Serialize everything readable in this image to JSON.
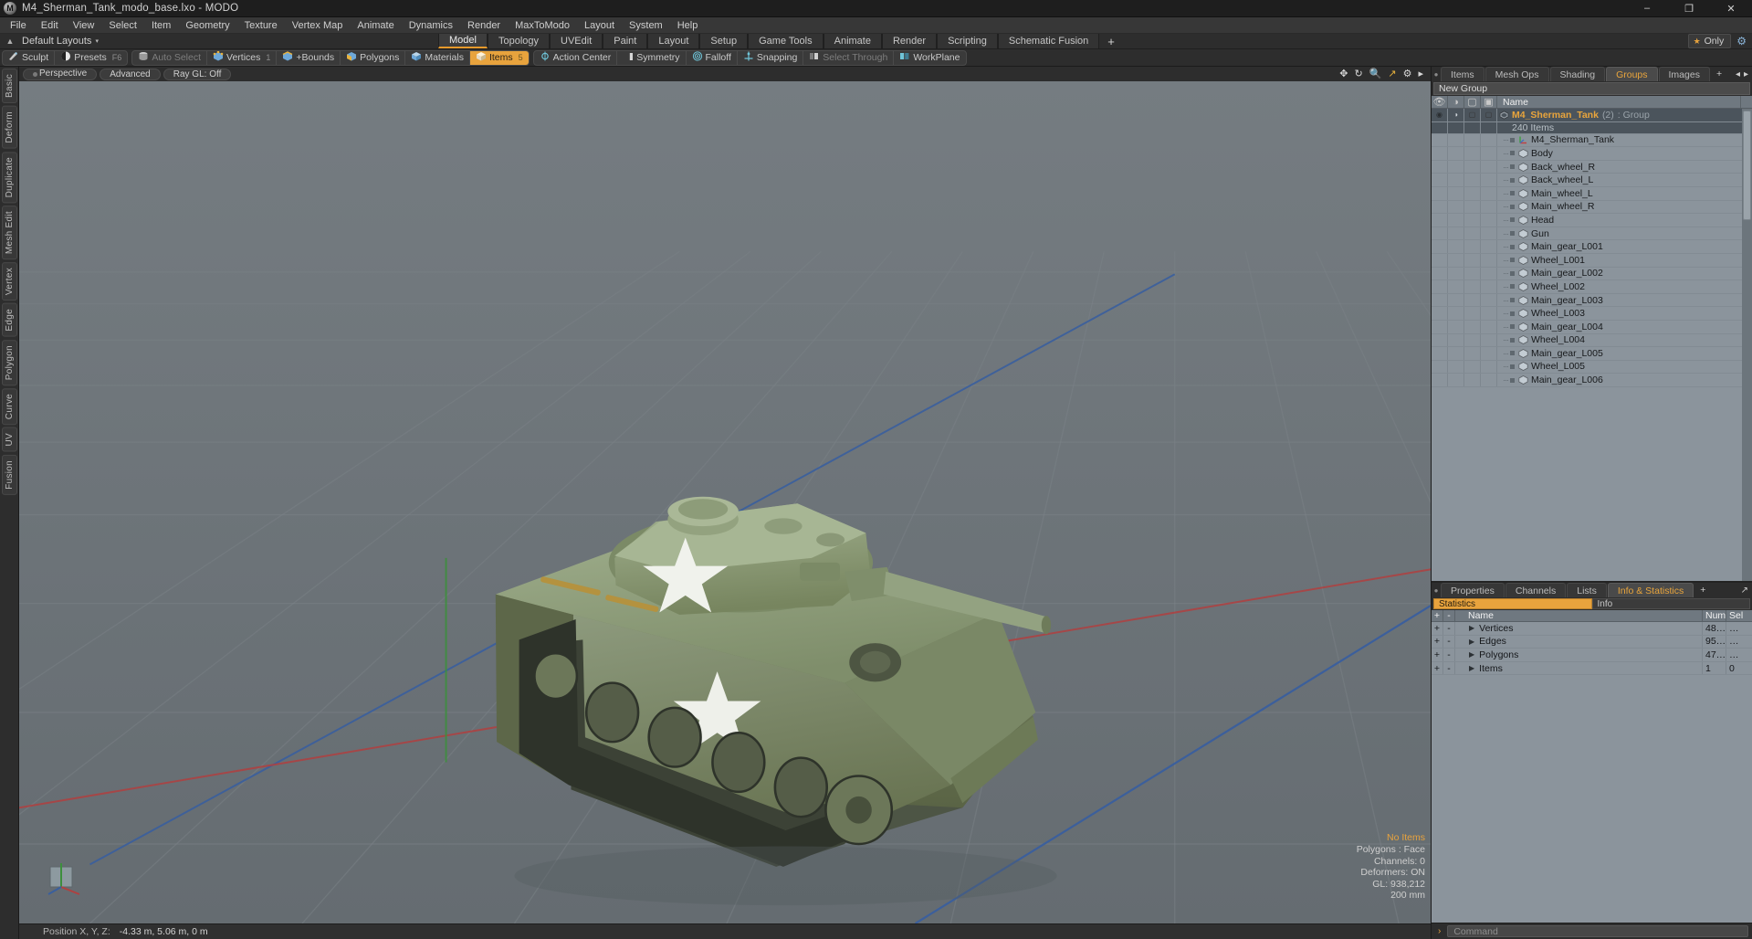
{
  "window": {
    "title": "M4_Sherman_Tank_modo_base.lxo - MODO",
    "minimize": "–",
    "maximize": "❐",
    "close": "✕"
  },
  "menubar": [
    "File",
    "Edit",
    "View",
    "Select",
    "Item",
    "Geometry",
    "Texture",
    "Vertex Map",
    "Animate",
    "Dynamics",
    "Render",
    "MaxToModo",
    "Layout",
    "System",
    "Help"
  ],
  "layoutrow": {
    "layout_label": "Default Layouts",
    "caret": "▾",
    "tabs": [
      {
        "label": "Model",
        "active": true
      },
      {
        "label": "Topology",
        "active": false
      },
      {
        "label": "UVEdit",
        "active": false
      },
      {
        "label": "Paint",
        "active": false
      },
      {
        "label": "Layout",
        "active": false
      },
      {
        "label": "Setup",
        "active": false
      },
      {
        "label": "Game Tools",
        "active": false
      },
      {
        "label": "Animate",
        "active": false
      },
      {
        "label": "Render",
        "active": false
      },
      {
        "label": "Scripting",
        "active": false
      },
      {
        "label": "Schematic Fusion",
        "active": false
      }
    ],
    "add_tab": "+",
    "only_label": "Only",
    "star": "★"
  },
  "toolbar": {
    "groups": [
      {
        "buttons": [
          {
            "label": "Sculpt",
            "icon": "brush-icon",
            "state": "normal",
            "hotkey": ""
          },
          {
            "label": "Presets",
            "icon": "sphere-icon",
            "state": "normal",
            "hotkey": "F6"
          }
        ]
      },
      {
        "buttons": [
          {
            "label": "Auto Select",
            "icon": "cylinder-icon",
            "state": "dim",
            "hotkey": ""
          },
          {
            "label": "Vertices",
            "icon": "vertex-cube-icon",
            "state": "normal",
            "hotkey": "1"
          },
          {
            "label": "+Bounds",
            "icon": "edge-cube-icon",
            "state": "normal",
            "hotkey": ""
          },
          {
            "label": "Polygons",
            "icon": "poly-cube-icon",
            "state": "normal",
            "hotkey": ""
          },
          {
            "label": "Materials",
            "icon": "material-cube-icon",
            "state": "normal",
            "hotkey": ""
          },
          {
            "label": "Items",
            "icon": "item-cube-icon",
            "state": "active",
            "hotkey": "5"
          }
        ]
      },
      {
        "buttons": [
          {
            "label": "Action Center",
            "icon": "action-center-icon",
            "state": "normal",
            "hotkey": ""
          },
          {
            "label": "Symmetry",
            "icon": "symmetry-icon",
            "state": "normal",
            "hotkey": ""
          },
          {
            "label": "Falloff",
            "icon": "falloff-icon",
            "state": "normal",
            "hotkey": ""
          },
          {
            "label": "Snapping",
            "icon": "snapping-icon",
            "state": "normal",
            "hotkey": ""
          },
          {
            "label": "Select Through",
            "icon": "select-through-icon",
            "state": "dim",
            "hotkey": ""
          },
          {
            "label": "WorkPlane",
            "icon": "workplane-icon",
            "state": "normal",
            "hotkey": ""
          }
        ]
      }
    ]
  },
  "leftstrip": [
    "Basic",
    "Deform",
    "Duplicate",
    "Mesh Edit",
    "Vertex",
    "Edge",
    "Polygon",
    "Curve",
    "UV",
    "Fusion"
  ],
  "viewport": {
    "pills": [
      {
        "label": "Perspective",
        "dot": true
      },
      {
        "label": "Advanced",
        "dot": false
      },
      {
        "label": "Ray GL: Off",
        "dot": false
      }
    ],
    "icons": [
      "move-icon",
      "rotate-icon",
      "zoom-icon",
      "fit-icon",
      "gear-icon",
      "chevron-right-icon"
    ],
    "info": {
      "selection": "No Items",
      "polygons": "Polygons : Face",
      "channels": "Channels: 0",
      "deformers": "Deformers: ON",
      "gl": "GL: 938,212",
      "grid": "200 mm"
    }
  },
  "statusbar": {
    "label": "Position X, Y, Z:",
    "value": "-4.33 m, 5.06 m, 0 m"
  },
  "rightpanel": {
    "tabs": [
      {
        "label": "Items",
        "active": false
      },
      {
        "label": "Mesh Ops",
        "active": false
      },
      {
        "label": "Shading",
        "active": false
      },
      {
        "label": "Groups",
        "active": true
      },
      {
        "label": "Images",
        "active": false
      }
    ],
    "add_tab": "+",
    "new_group_label": "New Group",
    "columns": [
      "eye-icon",
      "render-icon",
      "wire-cube-icon",
      "shade-cube-icon"
    ],
    "name_column": "Name",
    "group": {
      "name": "M4_Sherman_Tank",
      "count": "(2)",
      "type": ": Group",
      "items_count": "240 Items"
    },
    "items": [
      {
        "label": "M4_Sherman_Tank",
        "icon": "locator-icon"
      },
      {
        "label": "Body",
        "icon": "mesh-icon"
      },
      {
        "label": "Back_wheel_R",
        "icon": "mesh-icon"
      },
      {
        "label": "Back_wheel_L",
        "icon": "mesh-icon"
      },
      {
        "label": "Main_wheel_L",
        "icon": "mesh-icon"
      },
      {
        "label": "Main_wheel_R",
        "icon": "mesh-icon"
      },
      {
        "label": "Head",
        "icon": "mesh-icon"
      },
      {
        "label": "Gun",
        "icon": "mesh-icon"
      },
      {
        "label": "Main_gear_L001",
        "icon": "mesh-icon"
      },
      {
        "label": "Wheel_L001",
        "icon": "mesh-icon"
      },
      {
        "label": "Main_gear_L002",
        "icon": "mesh-icon"
      },
      {
        "label": "Wheel_L002",
        "icon": "mesh-icon"
      },
      {
        "label": "Main_gear_L003",
        "icon": "mesh-icon"
      },
      {
        "label": "Wheel_L003",
        "icon": "mesh-icon"
      },
      {
        "label": "Main_gear_L004",
        "icon": "mesh-icon"
      },
      {
        "label": "Wheel_L004",
        "icon": "mesh-icon"
      },
      {
        "label": "Main_gear_L005",
        "icon": "mesh-icon"
      },
      {
        "label": "Wheel_L005",
        "icon": "mesh-icon"
      },
      {
        "label": "Main_gear_L006",
        "icon": "mesh-icon"
      }
    ]
  },
  "bottompanel": {
    "tabs": [
      {
        "label": "Properties",
        "active": false
      },
      {
        "label": "Channels",
        "active": false
      },
      {
        "label": "Lists",
        "active": false
      },
      {
        "label": "Info & Statistics",
        "active": true
      }
    ],
    "add_tab": "+",
    "subtabs": [
      {
        "label": "Statistics",
        "active": true
      },
      {
        "label": "Info",
        "active": false
      }
    ],
    "headers": {
      "plus": "+",
      "minus": "-",
      "name": "Name",
      "num": "Num",
      "sel": "Sel"
    },
    "rows": [
      {
        "name": "Vertices",
        "num": "48…",
        "sel": "…"
      },
      {
        "name": "Edges",
        "num": "95…",
        "sel": "…"
      },
      {
        "name": "Polygons",
        "num": "47…",
        "sel": "…"
      },
      {
        "name": "Items",
        "num": "1",
        "sel": "0"
      }
    ]
  },
  "command": {
    "caret": "›",
    "placeholder": "Command"
  },
  "colors": {
    "accent": "#e8a33d",
    "panel": "#2d2d2d",
    "list_bg": "#8b949c",
    "viewport_bg": "#6e757a"
  }
}
